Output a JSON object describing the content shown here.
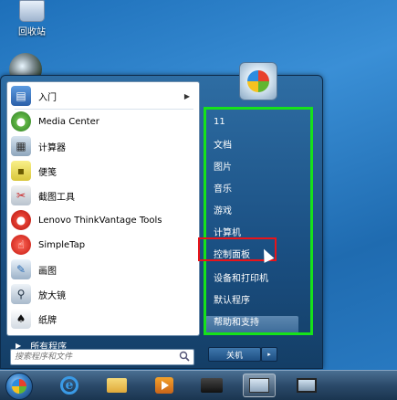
{
  "desktop": {
    "recycle_bin_label": "回收站"
  },
  "start_menu": {
    "left_items": [
      {
        "label": "入门",
        "icon": "getting-started-icon",
        "has_arrow": true
      },
      {
        "label": "Media Center",
        "icon": "media-center-icon"
      },
      {
        "label": "计算器",
        "icon": "calculator-icon"
      },
      {
        "label": "便笺",
        "icon": "sticky-notes-icon"
      },
      {
        "label": "截图工具",
        "icon": "snipping-tool-icon"
      },
      {
        "label": "Lenovo ThinkVantage Tools",
        "icon": "lenovo-tools-icon"
      },
      {
        "label": "SimpleTap",
        "icon": "simpletap-icon"
      },
      {
        "label": "画图",
        "icon": "paint-icon"
      },
      {
        "label": "放大镜",
        "icon": "magnifier-icon"
      },
      {
        "label": "纸牌",
        "icon": "solitaire-icon"
      }
    ],
    "all_programs_label": "所有程序",
    "search_placeholder": "搜索程序和文件",
    "right_items": [
      {
        "label": "11"
      },
      {
        "label": "文档"
      },
      {
        "label": "图片"
      },
      {
        "label": "音乐"
      },
      {
        "label": "游戏"
      },
      {
        "label": "计算机"
      },
      {
        "label": "控制面板",
        "highlighted": true
      },
      {
        "label": "设备和打印机"
      },
      {
        "label": "默认程序"
      },
      {
        "label": "帮助和支持"
      }
    ],
    "shutdown_label": "关机",
    "shutdown_arrow": "▸"
  },
  "colors": {
    "green_outline": "#16e21a",
    "red_outline": "#e8141a"
  }
}
